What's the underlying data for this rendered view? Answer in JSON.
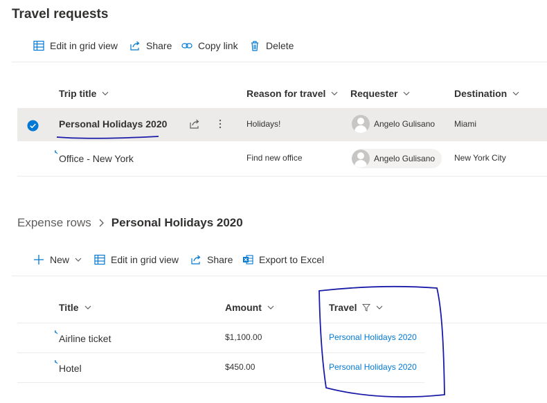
{
  "travel": {
    "title": "Travel requests",
    "toolbar": {
      "edit_grid": "Edit in grid view",
      "share": "Share",
      "copy_link": "Copy link",
      "delete": "Delete"
    },
    "columns": [
      "Trip title",
      "Reason for travel",
      "Requester",
      "Destination"
    ],
    "rows": [
      {
        "title": "Personal Holidays 2020",
        "reason": "Holidays!",
        "requester": "Angelo Gulisano",
        "destination": "Miami",
        "selected": true
      },
      {
        "title": "Office - New York",
        "reason": "Find new office",
        "requester": "Angelo Gulisano",
        "destination": "New York City",
        "selected": false
      }
    ]
  },
  "expenses": {
    "breadcrumb_parent": "Expense rows",
    "breadcrumb_current": "Personal Holidays 2020",
    "toolbar": {
      "new": "New",
      "edit_grid": "Edit in grid view",
      "share": "Share",
      "export": "Export to Excel"
    },
    "columns": [
      "Title",
      "Amount",
      "Travel"
    ],
    "rows": [
      {
        "title": "Airline ticket",
        "amount": "$1,100.00",
        "travel": "Personal Holidays 2020"
      },
      {
        "title": "Hotel",
        "amount": "$450.00",
        "travel": "Personal Holidays 2020"
      }
    ]
  },
  "colors": {
    "accent": "#0078d4",
    "annotation": "#1a1aa8",
    "selected_row": "#edebe9"
  }
}
